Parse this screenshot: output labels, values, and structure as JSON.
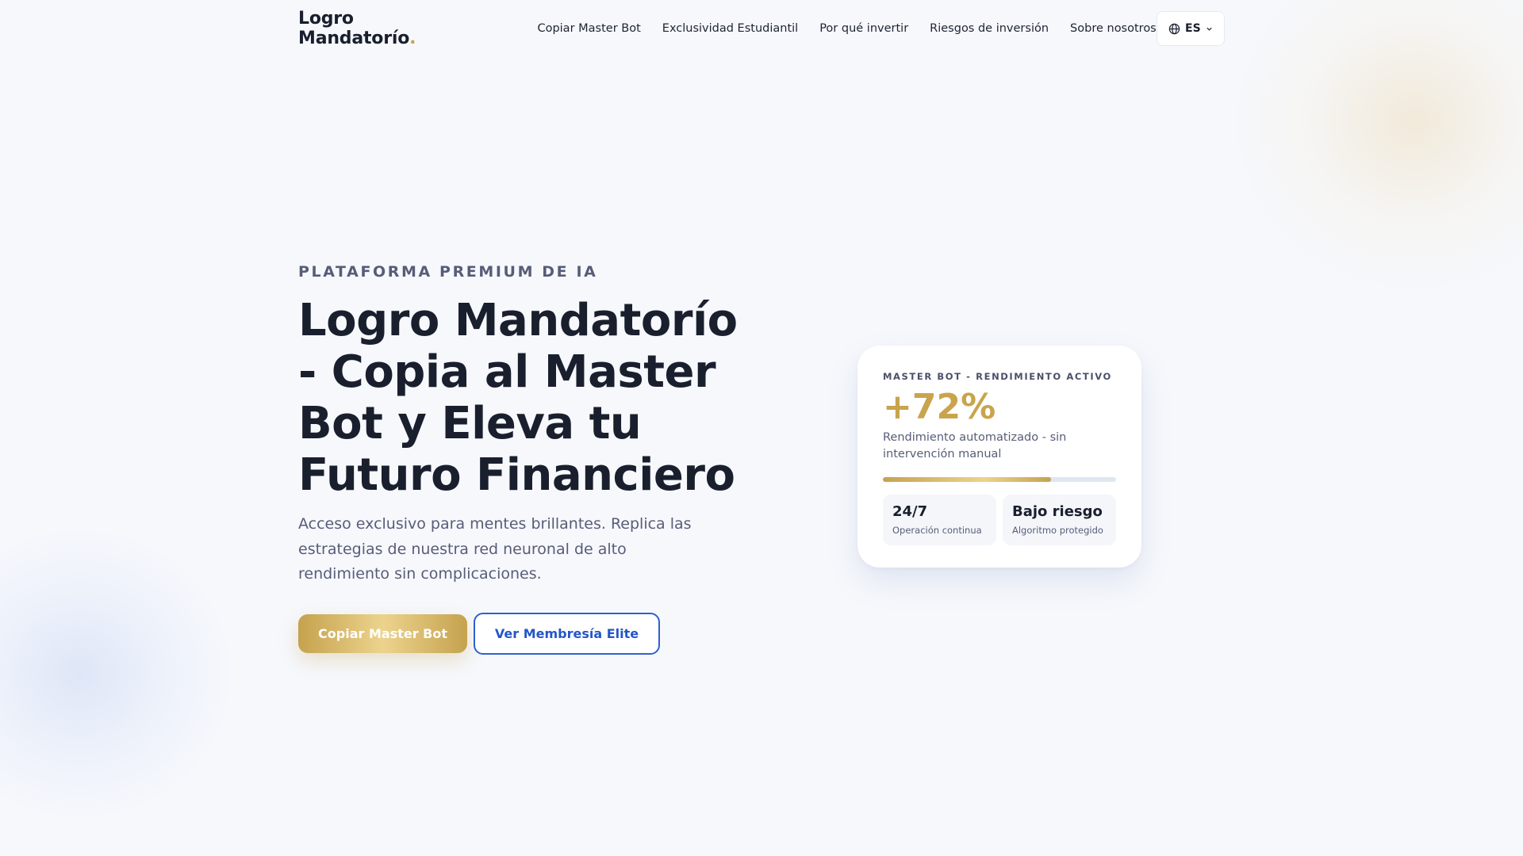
{
  "header": {
    "brand": "Logro Mandatorío",
    "brand_dot": ".",
    "nav": [
      "Copiar Master Bot",
      "Exclusividad Estudiantil",
      "Por qué invertir",
      "Riesgos de inversión",
      "Sobre nosotros"
    ],
    "language": "ES",
    "language_icon": "globe-icon"
  },
  "hero": {
    "eyebrow": "PLATAFORMA PREMIUM DE IA",
    "title": "Logro Mandatorío - Copia al Master Bot y Eleva tu Futuro Financiero",
    "subtitle": "Acceso exclusivo para mentes brillantes. Replica las estrategias de nuestra red neuronal de alto rendimiento sin complicaciones.",
    "primary_cta": "Copiar Master Bot",
    "secondary_cta": "Ver Membresía Elite"
  },
  "card": {
    "label": "MASTER BOT - RENDIMIENTO ACTIVO",
    "value": "+72%",
    "description": "Rendimiento automatizado - sin intervención manual",
    "progress_fraction": 0.72,
    "stats": [
      {
        "value": "24/7",
        "label": "Operación continua"
      },
      {
        "value": "Bajo riesgo",
        "label": "Algoritmo protegido"
      }
    ]
  },
  "colors": {
    "accent_gold": "#c9a44c",
    "accent_blue": "#2f5fd0",
    "text_dark": "#1a1f2e",
    "text_muted": "#575d78",
    "background": "#f6f8fc"
  }
}
